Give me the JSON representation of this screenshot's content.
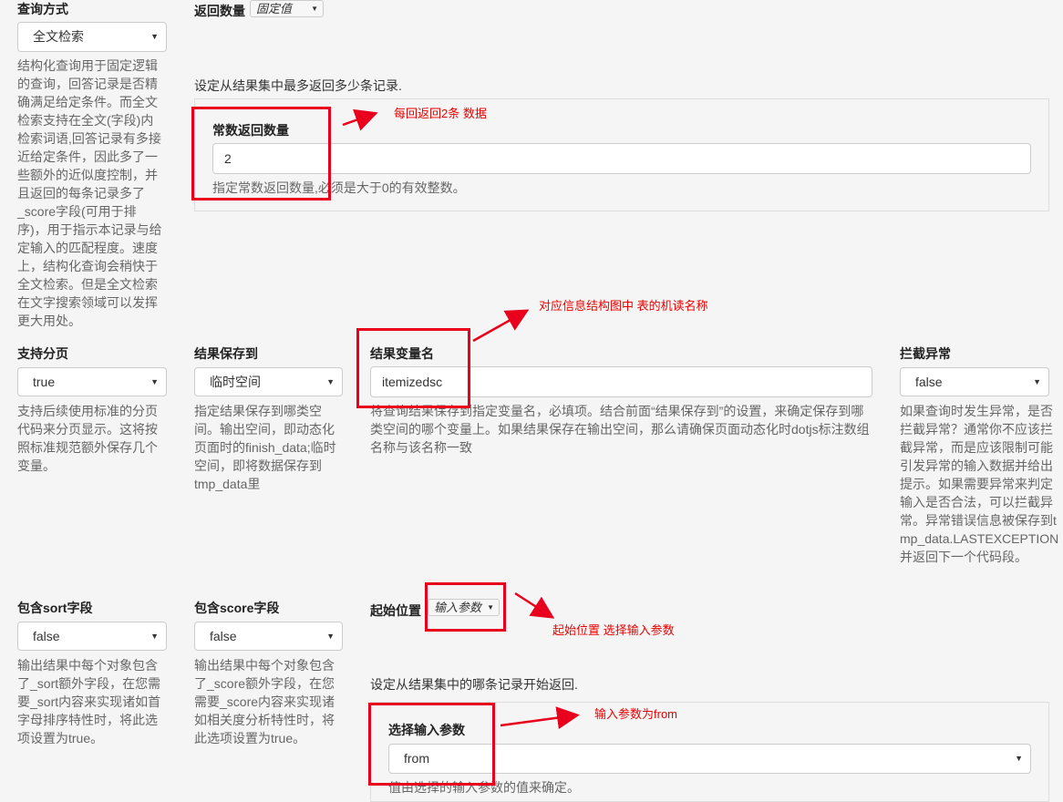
{
  "query_mode": {
    "label": "查询方式",
    "value": "全文检索",
    "help": "结构化查询用于固定逻辑的查询，回答记录是否精确满足给定条件。而全文检索支持在全文(字段)内检索词语,回答记录有多接近给定条件，因此多了一些额外的近似度控制，并且返回的每条记录多了_score字段(可用于排序)，用于指示本记录与给定输入的匹配程度。速度上，结构化查询会稍快于全文检索。但是全文检索在文字搜索领域可以发挥更大用处。"
  },
  "return_count": {
    "label": "返回数量",
    "mode": "固定值",
    "desc": "设定从结果集中最多返回多少条记录.",
    "const_label": "常数返回数量",
    "const_value": "2",
    "const_help": "指定常数返回数量,必须是大于0的有效整数。"
  },
  "paging": {
    "label": "支持分页",
    "value": "true",
    "help": "支持后续使用标准的分页代码来分页显示。这将按照标准规范额外保存几个变量。"
  },
  "result_save": {
    "label": "结果保存到",
    "value": "临时空间",
    "help": "指定结果保存到哪类空间。输出空间，即动态化页面时的finish_data;临时空间，即将数据保存到tmp_data里"
  },
  "result_var": {
    "label": "结果变量名",
    "value": "itemizedsc",
    "help": "将查询结果保存到指定变量名，必填项。结合前面“结果保存到”的设置，来确定保存到哪类空间的哪个变量上。如果结果保存在输出空间，那么请确保页面动态化时dotjs标注数组名称与该名称一致"
  },
  "intercept": {
    "label": "拦截异常",
    "value": "false",
    "help": "如果查询时发生异常，是否拦截异常？通常你不应该拦截异常，而是应该限制可能引发异常的输入数据并给出提示。如果需要异常来判定输入是否合法，可以拦截异常。异常错误信息被保存到tmp_data.LASTEXCEPTION并返回下一个代码段。"
  },
  "sort_field": {
    "label": "包含sort字段",
    "value": "false",
    "help": "输出结果中每个对象包含了_sort额外字段，在您需要_sort内容来实现诸如首字母排序特性时，将此选项设置为true。"
  },
  "score_field": {
    "label": "包含score字段",
    "value": "false",
    "help": "输出结果中每个对象包含了_score额外字段，在您需要_score内容来实现诸如相关度分析特性时，将此选项设置为true。"
  },
  "start_pos": {
    "label": "起始位置",
    "mode": "输入参数",
    "desc": "设定从结果集中的哪条记录开始返回.",
    "param_label": "选择输入参数",
    "param_value": "from",
    "param_help": "值由选择的输入参数的值来确定。"
  },
  "annotations": {
    "a1": "每回返回2条 数据",
    "a2": "对应信息结构图中 表的机读名称",
    "a3": "起始位置 选择输入参数",
    "a4": "输入参数为from"
  },
  "colors": {
    "annotation": "#e8001c",
    "background": "#f5f5f5"
  }
}
